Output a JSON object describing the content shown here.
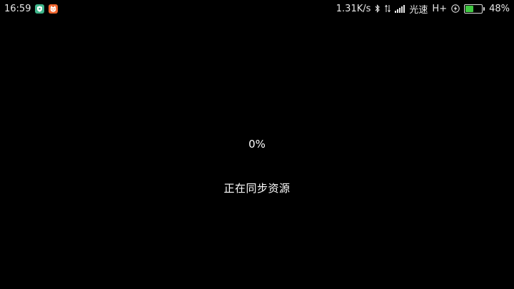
{
  "status_bar": {
    "time": "16:59",
    "notification_icons": [
      "shield-app-icon",
      "cat-app-icon"
    ],
    "network_speed": "1.31K/s",
    "bluetooth_icon": "bluetooth-icon",
    "data_arrows_icon": "data-transfer-icon",
    "signal_icon": "signal-icon",
    "carrier": "光速",
    "network_type": "H+",
    "charging_icon": "charging-icon",
    "battery_level": 0.48,
    "battery_percent": "48%",
    "colors": {
      "battery_fill": "#40c942",
      "green_app": "#3fb68b",
      "orange_app": "#f0662f"
    }
  },
  "main": {
    "progress_percent": "0%",
    "message": "正在同步资源"
  },
  "colors": {
    "background": "#000000",
    "text": "#ffffff"
  }
}
